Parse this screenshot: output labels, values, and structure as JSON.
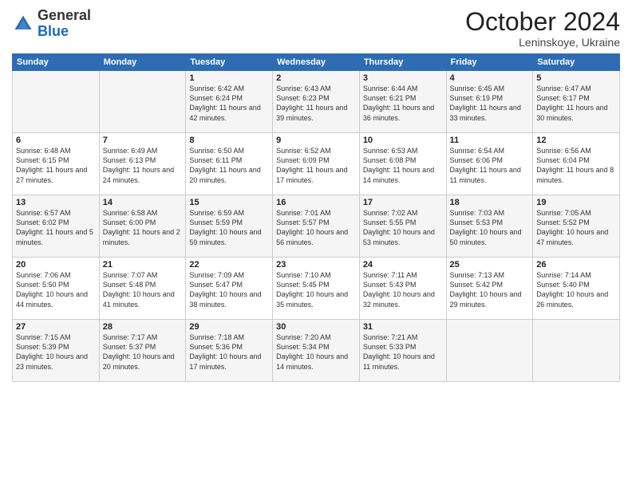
{
  "header": {
    "logo_general": "General",
    "logo_blue": "Blue",
    "month": "October 2024",
    "location": "Leninskoye, Ukraine"
  },
  "days_of_week": [
    "Sunday",
    "Monday",
    "Tuesday",
    "Wednesday",
    "Thursday",
    "Friday",
    "Saturday"
  ],
  "weeks": [
    [
      {
        "day": "",
        "detail": ""
      },
      {
        "day": "",
        "detail": ""
      },
      {
        "day": "1",
        "detail": "Sunrise: 6:42 AM\nSunset: 6:24 PM\nDaylight: 11 hours and 42 minutes."
      },
      {
        "day": "2",
        "detail": "Sunrise: 6:43 AM\nSunset: 6:23 PM\nDaylight: 11 hours and 39 minutes."
      },
      {
        "day": "3",
        "detail": "Sunrise: 6:44 AM\nSunset: 6:21 PM\nDaylight: 11 hours and 36 minutes."
      },
      {
        "day": "4",
        "detail": "Sunrise: 6:45 AM\nSunset: 6:19 PM\nDaylight: 11 hours and 33 minutes."
      },
      {
        "day": "5",
        "detail": "Sunrise: 6:47 AM\nSunset: 6:17 PM\nDaylight: 11 hours and 30 minutes."
      }
    ],
    [
      {
        "day": "6",
        "detail": "Sunrise: 6:48 AM\nSunset: 6:15 PM\nDaylight: 11 hours and 27 minutes."
      },
      {
        "day": "7",
        "detail": "Sunrise: 6:49 AM\nSunset: 6:13 PM\nDaylight: 11 hours and 24 minutes."
      },
      {
        "day": "8",
        "detail": "Sunrise: 6:50 AM\nSunset: 6:11 PM\nDaylight: 11 hours and 20 minutes."
      },
      {
        "day": "9",
        "detail": "Sunrise: 6:52 AM\nSunset: 6:09 PM\nDaylight: 11 hours and 17 minutes."
      },
      {
        "day": "10",
        "detail": "Sunrise: 6:53 AM\nSunset: 6:08 PM\nDaylight: 11 hours and 14 minutes."
      },
      {
        "day": "11",
        "detail": "Sunrise: 6:54 AM\nSunset: 6:06 PM\nDaylight: 11 hours and 11 minutes."
      },
      {
        "day": "12",
        "detail": "Sunrise: 6:56 AM\nSunset: 6:04 PM\nDaylight: 11 hours and 8 minutes."
      }
    ],
    [
      {
        "day": "13",
        "detail": "Sunrise: 6:57 AM\nSunset: 6:02 PM\nDaylight: 11 hours and 5 minutes."
      },
      {
        "day": "14",
        "detail": "Sunrise: 6:58 AM\nSunset: 6:00 PM\nDaylight: 11 hours and 2 minutes."
      },
      {
        "day": "15",
        "detail": "Sunrise: 6:59 AM\nSunset: 5:59 PM\nDaylight: 10 hours and 59 minutes."
      },
      {
        "day": "16",
        "detail": "Sunrise: 7:01 AM\nSunset: 5:57 PM\nDaylight: 10 hours and 56 minutes."
      },
      {
        "day": "17",
        "detail": "Sunrise: 7:02 AM\nSunset: 5:55 PM\nDaylight: 10 hours and 53 minutes."
      },
      {
        "day": "18",
        "detail": "Sunrise: 7:03 AM\nSunset: 5:53 PM\nDaylight: 10 hours and 50 minutes."
      },
      {
        "day": "19",
        "detail": "Sunrise: 7:05 AM\nSunset: 5:52 PM\nDaylight: 10 hours and 47 minutes."
      }
    ],
    [
      {
        "day": "20",
        "detail": "Sunrise: 7:06 AM\nSunset: 5:50 PM\nDaylight: 10 hours and 44 minutes."
      },
      {
        "day": "21",
        "detail": "Sunrise: 7:07 AM\nSunset: 5:48 PM\nDaylight: 10 hours and 41 minutes."
      },
      {
        "day": "22",
        "detail": "Sunrise: 7:09 AM\nSunset: 5:47 PM\nDaylight: 10 hours and 38 minutes."
      },
      {
        "day": "23",
        "detail": "Sunrise: 7:10 AM\nSunset: 5:45 PM\nDaylight: 10 hours and 35 minutes."
      },
      {
        "day": "24",
        "detail": "Sunrise: 7:11 AM\nSunset: 5:43 PM\nDaylight: 10 hours and 32 minutes."
      },
      {
        "day": "25",
        "detail": "Sunrise: 7:13 AM\nSunset: 5:42 PM\nDaylight: 10 hours and 29 minutes."
      },
      {
        "day": "26",
        "detail": "Sunrise: 7:14 AM\nSunset: 5:40 PM\nDaylight: 10 hours and 26 minutes."
      }
    ],
    [
      {
        "day": "27",
        "detail": "Sunrise: 7:15 AM\nSunset: 5:39 PM\nDaylight: 10 hours and 23 minutes."
      },
      {
        "day": "28",
        "detail": "Sunrise: 7:17 AM\nSunset: 5:37 PM\nDaylight: 10 hours and 20 minutes."
      },
      {
        "day": "29",
        "detail": "Sunrise: 7:18 AM\nSunset: 5:36 PM\nDaylight: 10 hours and 17 minutes."
      },
      {
        "day": "30",
        "detail": "Sunrise: 7:20 AM\nSunset: 5:34 PM\nDaylight: 10 hours and 14 minutes."
      },
      {
        "day": "31",
        "detail": "Sunrise: 7:21 AM\nSunset: 5:33 PM\nDaylight: 10 hours and 11 minutes."
      },
      {
        "day": "",
        "detail": ""
      },
      {
        "day": "",
        "detail": ""
      }
    ]
  ]
}
